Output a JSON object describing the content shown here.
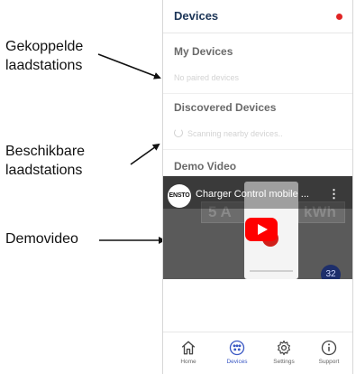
{
  "annotations": {
    "paired_line1": "Gekoppelde",
    "paired_line2": "laadstations",
    "available_line1": "Beschikbare",
    "available_line2": "laadstations",
    "video": "Demovideo"
  },
  "app": {
    "title": "Devices",
    "status_color": "#e02424",
    "accent": "#1c3557"
  },
  "my_devices": {
    "heading": "My Devices",
    "empty_text": "No paired devices"
  },
  "discovered": {
    "heading": "Discovered Devices",
    "status_text": "Scanning nearby devices..",
    "icon": "spinner-icon"
  },
  "demo": {
    "heading": "Demo Video",
    "video_title": "Charger Control mobile ...",
    "channel_logo_text": "ENSTO",
    "bg_text_left": "5 A",
    "bg_text_right": "kWh",
    "badge_number": "32",
    "play_icon": "play-icon",
    "menu_icon": "more-vert-icon"
  },
  "nav": {
    "items": [
      {
        "label": "Home",
        "icon": "home-icon",
        "active": false
      },
      {
        "label": "Devices",
        "icon": "devices-icon",
        "active": true
      },
      {
        "label": "Settings",
        "icon": "settings-icon",
        "active": false
      },
      {
        "label": "Support",
        "icon": "info-icon",
        "active": false
      }
    ],
    "active_color": "#3b59c4"
  }
}
